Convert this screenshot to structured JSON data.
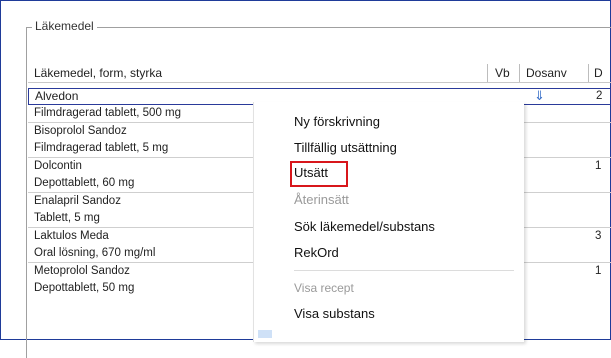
{
  "group": {
    "title": "Läkemedel"
  },
  "table": {
    "columns": [
      "Läkemedel, form, styrka",
      "Vb",
      "Dosanv",
      "D"
    ],
    "selected_row": {
      "name": "Alvedon",
      "dosanv_symbol": "⇓",
      "d_value": "2"
    },
    "rows": [
      {
        "name": "Filmdragerad tablett, 500 mg",
        "d_value": ""
      },
      {
        "name": "Bisoprolol Sandoz",
        "d_value": ""
      },
      {
        "name": "Filmdragerad tablett, 5 mg",
        "d_value": ""
      },
      {
        "name": "Dolcontin",
        "d_value": "1"
      },
      {
        "name": "Depottablett, 60 mg",
        "d_value": ""
      },
      {
        "name": "Enalapril Sandoz",
        "d_value": ""
      },
      {
        "name": "Tablett, 5 mg",
        "d_value": ""
      },
      {
        "name": "Laktulos Meda",
        "d_value": "3"
      },
      {
        "name": "Oral lösning, 670 mg/ml",
        "d_value": ""
      },
      {
        "name": "Metoprolol Sandoz",
        "d_value": "1"
      },
      {
        "name": "Depottablett, 50 mg",
        "d_value": ""
      }
    ]
  },
  "context_menu": {
    "items": [
      {
        "label": "Ny förskrivning",
        "disabled": false
      },
      {
        "label": "Tillfällig utsättning",
        "disabled": false
      },
      {
        "label": "Utsätt",
        "disabled": false
      },
      {
        "label": "Återinsätt",
        "disabled": true
      },
      {
        "label": "Sök läkemedel/substans",
        "disabled": false
      },
      {
        "label": "RekOrd",
        "disabled": false
      },
      {
        "label": "Visa recept",
        "disabled": true
      },
      {
        "label": "Visa substans",
        "disabled": false
      }
    ]
  },
  "colors": {
    "highlight": "#d8161b",
    "selection_border": "#2a3a9a",
    "frame": "#1f3b99"
  }
}
